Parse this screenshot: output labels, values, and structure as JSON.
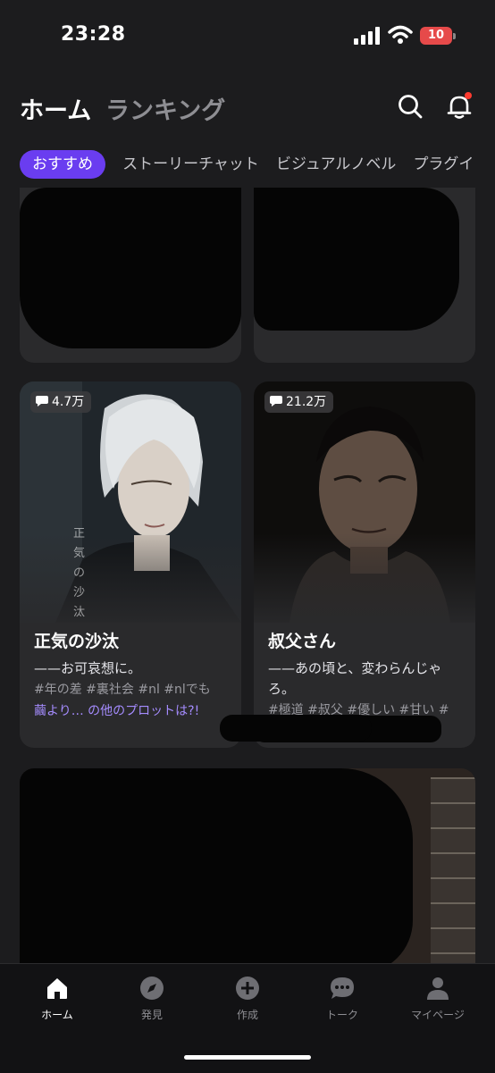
{
  "status": {
    "time": "23:28",
    "battery": "10"
  },
  "header": {
    "tabs": [
      {
        "label": "ホーム",
        "active": true
      },
      {
        "label": "ランキング",
        "active": false
      }
    ],
    "icons": [
      "search-icon",
      "bell-icon"
    ]
  },
  "categories": [
    "おすすめ",
    "ストーリーチャット",
    "ビジュアルノベル",
    "プラグイ"
  ],
  "cards": [
    {
      "views": "4.7万",
      "title": "正気の沙汰",
      "description": "——お可哀想に。",
      "tags": "#年の差 #裏社会 #nl #nlでも",
      "link": "繭より… の他のプロットは?!",
      "cover_text": "正気の沙汰"
    },
    {
      "views": "21.2万",
      "title": "叔父さん",
      "description": "——あの頃と、変わらんじゃろ。",
      "tags": "#極道 #叔父 #優しい #甘い #"
    }
  ],
  "tabbar": [
    {
      "label": "ホーム",
      "icon": "home-icon",
      "active": true
    },
    {
      "label": "発見",
      "icon": "compass-icon",
      "active": false
    },
    {
      "label": "作成",
      "icon": "plus-circle-icon",
      "active": false
    },
    {
      "label": "トーク",
      "icon": "chat-bubble-icon",
      "active": false
    },
    {
      "label": "マイページ",
      "icon": "person-icon",
      "active": false
    }
  ],
  "colors": {
    "accent": "#6a3df0",
    "link": "#a58cff",
    "background": "#1c1c1e",
    "card": "#2a2a2c",
    "badge_red": "#ff3b30"
  }
}
